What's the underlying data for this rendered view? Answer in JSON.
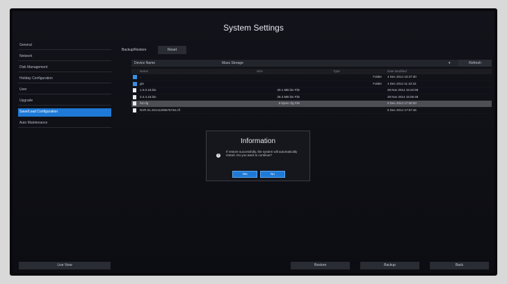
{
  "title": "System Settings",
  "sidebar": {
    "items": [
      {
        "label": "General"
      },
      {
        "label": "Network"
      },
      {
        "label": "Disk Management"
      },
      {
        "label": "Holiday Configuration"
      },
      {
        "label": "User"
      },
      {
        "label": "Upgrade"
      },
      {
        "label": "Save/Load Configuration"
      },
      {
        "label": "Auto Maintenance"
      }
    ],
    "active_index": 6
  },
  "tabs": [
    {
      "label": "Backup/Restore"
    },
    {
      "label": "Reset"
    }
  ],
  "device": {
    "label": "Device Name",
    "selected": "Mass Storage",
    "refresh_label": "Refresh"
  },
  "table": {
    "headers": [
      "Name",
      "Size",
      "Type",
      "Date Modified"
    ],
    "rows": [
      {
        "name": "..",
        "size": "",
        "type": "Folder",
        "date": "4 Dec 2014 10:37:30",
        "icon": "folder-icon"
      },
      {
        "name": "gin",
        "size": "",
        "type": "Folder",
        "date": "4 Dec 2014 11:42:22",
        "icon": "folder-icon"
      },
      {
        "name": "1.0.0.16.bin",
        "size": "29.1 MB bin File",
        "type": "",
        "date": "28 Nov 2014 15:22:58",
        "icon": "file-icon"
      },
      {
        "name": "3.4.4.16.bin",
        "size": "28.3 MB bin File",
        "type": "",
        "date": "28 Nov 2014 15:05:48",
        "icon": "file-icon"
      },
      {
        "name": "hd.cfg",
        "size": "5 bytes cfg File",
        "type": "",
        "date": "5 Dec 2014 17:50:00",
        "icon": "file-icon"
      },
      {
        "name": "NVR.01.20141205575746.cfl",
        "size": "",
        "type": "",
        "date": "5 Dec 2014 17:57:46",
        "icon": "file-icon"
      }
    ],
    "highlight_index": 4
  },
  "dialog": {
    "title": "Information",
    "message": "If restore successfully, the system will automatically restart. Do you want to continue?",
    "yes_label": "Yes",
    "no_label": "No"
  },
  "bottom": {
    "live_view_label": "Live View",
    "restore_label": "Restore",
    "backup_label": "Backup",
    "back_label": "Back"
  },
  "colors": {
    "accent": "#1e7ad6",
    "background": "#0c0d12"
  }
}
